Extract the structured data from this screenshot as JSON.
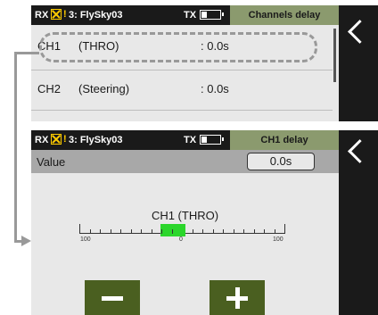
{
  "screen1": {
    "status": {
      "rx": "RX",
      "warning": "!",
      "model": "3: FlySky03",
      "tx": "TX",
      "title": "Channels delay"
    },
    "rows": [
      {
        "name": "CH1",
        "function": "(THRO)",
        "value": ": 0.0s"
      },
      {
        "name": "CH2",
        "function": "(Steering)",
        "value": ": 0.0s"
      }
    ]
  },
  "screen2": {
    "status": {
      "rx": "RX",
      "warning": "!",
      "model": "3: FlySky03",
      "tx": "TX",
      "title": "CH1  delay"
    },
    "value_label": "Value",
    "value": "0.0s",
    "channel_label": "CH1  (THRO)",
    "ticks": {
      "left": "100",
      "center": "0",
      "right": "100"
    },
    "delay_fraction": 0.0
  },
  "colors": {
    "title_bg": "#8b9a6e",
    "button_bg": "#4a5f20",
    "bar_fill": "#2bd62b",
    "warning": "#ffcc00"
  },
  "icons": [
    "back-chevron-icon",
    "receiver-disconnected-icon",
    "warning-icon",
    "battery-icon",
    "minus-icon",
    "plus-icon"
  ]
}
